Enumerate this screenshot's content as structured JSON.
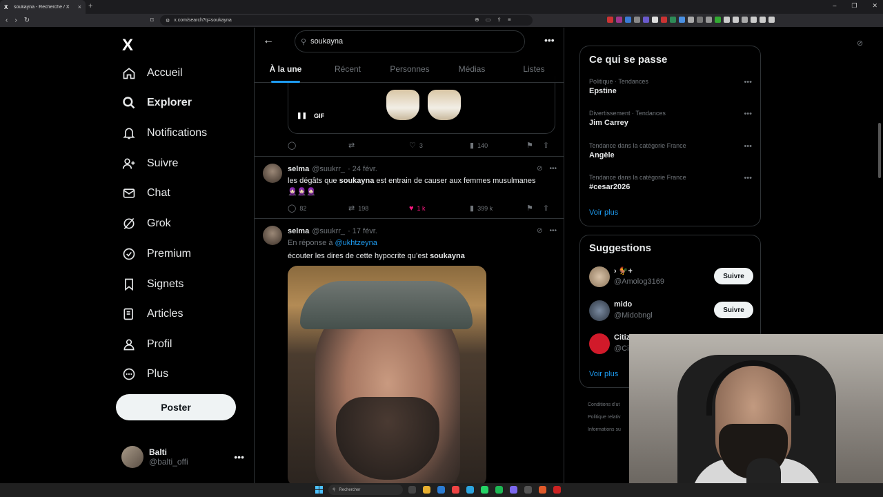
{
  "browser": {
    "tab_title": "soukayna - Recherche / X",
    "tab_favicon": "X",
    "url": "x.com/search?q=soukayna",
    "close_label": "×",
    "newtab_label": "+"
  },
  "leftnav": {
    "logo": "X",
    "items": [
      {
        "label": "Accueil",
        "icon": "home-icon"
      },
      {
        "label": "Explorer",
        "icon": "search-icon"
      },
      {
        "label": "Notifications",
        "icon": "bell-icon"
      },
      {
        "label": "Suivre",
        "icon": "follow-icon"
      },
      {
        "label": "Chat",
        "icon": "mail-icon"
      },
      {
        "label": "Grok",
        "icon": "grok-icon"
      },
      {
        "label": "Premium",
        "icon": "verified-icon"
      },
      {
        "label": "Signets",
        "icon": "bookmark-icon"
      },
      {
        "label": "Articles",
        "icon": "article-icon"
      },
      {
        "label": "Profil",
        "icon": "person-icon"
      },
      {
        "label": "Plus",
        "icon": "more-circle-icon"
      }
    ],
    "post_label": "Poster",
    "account": {
      "name": "Balti",
      "handle": "@balti_offi"
    }
  },
  "search": {
    "query": "soukayna",
    "tabs": [
      "À la une",
      "Récent",
      "Personnes",
      "Médias",
      "Listes"
    ],
    "active_tab": 0
  },
  "top_tweet": {
    "gif_label": "GIF",
    "likes": "3",
    "views": "140"
  },
  "tweets": [
    {
      "name": "selma",
      "handle": "@suukrr_",
      "date": "· 24 févr.",
      "text_before": "les dégâts que ",
      "text_bold": "soukayna",
      "text_after": " est entrain de causer aux femmes musulmanes",
      "emojis": "🧕🏻🧕🏻🧕🏻",
      "replies": "82",
      "retweets": "198",
      "likes": "1 k",
      "views": "399 k"
    },
    {
      "name": "selma",
      "handle": "@suukrr_",
      "date": "· 17 févr.",
      "reply_prefix": "En réponse à ",
      "reply_to": "@ukhtzeyna",
      "text_before": "écouter les dires de cette hypocrite qu’est ",
      "text_bold": "soukayna"
    }
  ],
  "trends": {
    "title": "Ce qui se passe",
    "items": [
      {
        "meta": "Politique · Tendances",
        "term": "Epstine"
      },
      {
        "meta": "Divertissement · Tendances",
        "term": "Jim Carrey"
      },
      {
        "meta": "Tendance dans la catégorie France",
        "term": "Angèle"
      },
      {
        "meta": "Tendance dans la catégorie France",
        "term": "#cesar2026"
      }
    ],
    "see_more": "Voir plus"
  },
  "suggestions": {
    "title": "Suggestions",
    "items": [
      {
        "name": "› 🐓+",
        "handle": "@Amolog3169",
        "follow": "Suivre"
      },
      {
        "name": "mido",
        "handle": "@Midobngl",
        "follow": "Suivre"
      },
      {
        "name": "Citiz",
        "handle": "@Ci",
        "follow": ""
      }
    ],
    "see_more": "Voir plus"
  },
  "footer": [
    "Conditions d’ut",
    "Politique relativ",
    "Informations su"
  ],
  "taskbar": {
    "search_placeholder": "Rechercher"
  },
  "colors": {
    "accent": "#1d9bf0",
    "like": "#f91880",
    "border": "#2f3336",
    "muted": "#71767b"
  }
}
